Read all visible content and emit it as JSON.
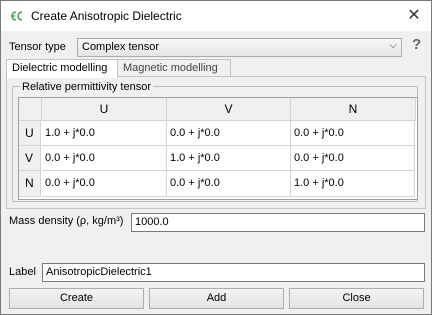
{
  "window": {
    "title": "Create Anisotropic Dielectric",
    "close_glyph": "✕"
  },
  "tensor_type": {
    "label": "Tensor type",
    "selected": "Complex tensor",
    "help_glyph": "?"
  },
  "tabs": [
    {
      "label": "Dielectric modelling"
    },
    {
      "label": "Magnetic modelling"
    }
  ],
  "permittivity": {
    "title": "Relative permittivity tensor",
    "columns": [
      "U",
      "V",
      "N"
    ],
    "rows": [
      {
        "label": "U",
        "cells": [
          "1.0 + j*0.0",
          "0.0 + j*0.0",
          "0.0 + j*0.0"
        ]
      },
      {
        "label": "V",
        "cells": [
          "0.0 + j*0.0",
          "1.0 + j*0.0",
          "0.0 + j*0.0"
        ]
      },
      {
        "label": "N",
        "cells": [
          "0.0 + j*0.0",
          "0.0 + j*0.0",
          "1.0 + j*0.0"
        ]
      }
    ]
  },
  "mass_density": {
    "label": "Mass density (ρ, kg/m³)",
    "value": "1000.0"
  },
  "label_field": {
    "label": "Label",
    "value": "AnisotropicDielectric1"
  },
  "buttons": {
    "create": "Create",
    "add": "Add",
    "close": "Close"
  },
  "colors": {
    "icon_green": "#3aa55a",
    "titlebar": "#ffffff",
    "dialog_bg": "#f0f0f0"
  }
}
